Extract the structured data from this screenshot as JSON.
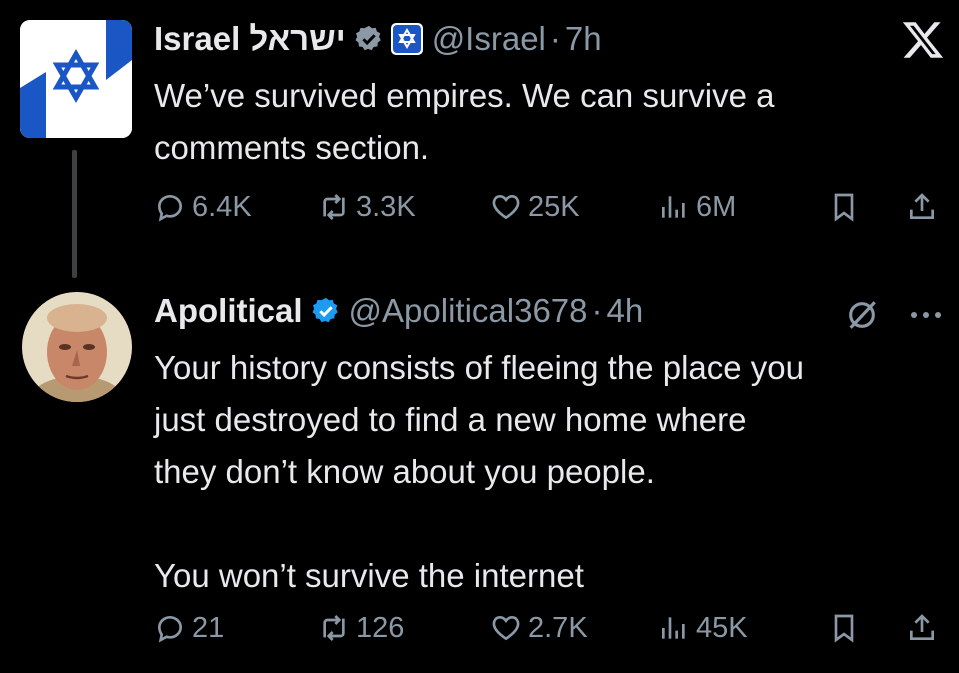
{
  "tweets": [
    {
      "name": "Israel ישראל",
      "handle": "@Israel",
      "dot": "·",
      "time": "7h",
      "text": "We’ve survived empires. We can survive a\ncomments section.",
      "stats": {
        "replies": "6.4K",
        "reposts": "3.3K",
        "likes": "25K",
        "views": "6M"
      }
    },
    {
      "name": "Apolitical",
      "handle": "@Apolitical3678",
      "dot": "·",
      "time": "4h",
      "text": "Your history consists of fleeing the place you\njust destroyed to find a new home where\nthey don’t know about you people.\n\nYou won’t survive the internet",
      "stats": {
        "replies": "21",
        "reposts": "126",
        "likes": "2.7K",
        "views": "45K"
      }
    }
  ],
  "colors": {
    "background": "#000000",
    "text": "#e7e9ea",
    "secondary": "#8b98a5",
    "verified_gray": "#8b98a5",
    "verified_blue": "#1d9bf0",
    "flag_blue": "#1a56c4"
  },
  "icons": [
    "x-logo-icon",
    "verified-badge-icon",
    "affiliate-badge-icon",
    "reply-icon",
    "repost-icon",
    "like-icon",
    "views-icon",
    "bookmark-icon",
    "share-icon",
    "grok-icon",
    "more-icon"
  ]
}
